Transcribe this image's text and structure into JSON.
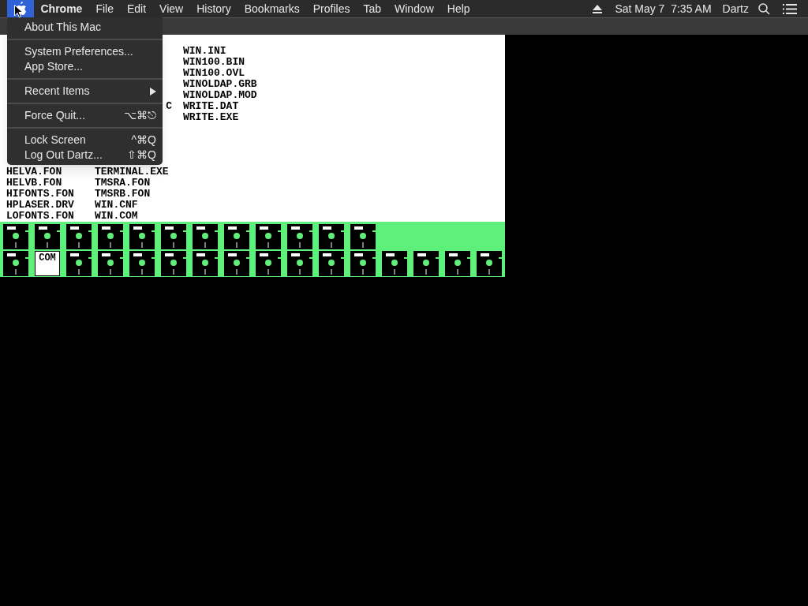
{
  "menu_bar": {
    "apple_selected": true,
    "items": [
      {
        "label": "Chrome",
        "bold": true,
        "selected": false
      },
      {
        "label": "File",
        "bold": false,
        "selected": false
      },
      {
        "label": "Edit",
        "bold": false,
        "selected": false
      },
      {
        "label": "View",
        "bold": false,
        "selected": false
      },
      {
        "label": "History",
        "bold": false,
        "selected": false
      },
      {
        "label": "Bookmarks",
        "bold": false,
        "selected": false
      },
      {
        "label": "Profiles",
        "bold": false,
        "selected": false
      },
      {
        "label": "Tab",
        "bold": false,
        "selected": false
      },
      {
        "label": "Window",
        "bold": false,
        "selected": false
      },
      {
        "label": "Help",
        "bold": false,
        "selected": false
      }
    ],
    "clock": "Sat May 7  7:35 AM",
    "user": "Dartz"
  },
  "apple_menu": [
    {
      "kind": "item",
      "label": "About This Mac"
    },
    {
      "kind": "separator"
    },
    {
      "kind": "item",
      "label": "System Preferences..."
    },
    {
      "kind": "item",
      "label": "App Store..."
    },
    {
      "kind": "separator"
    },
    {
      "kind": "item",
      "label": "Recent Items",
      "submenu": true
    },
    {
      "kind": "separator"
    },
    {
      "kind": "item",
      "label": "Force Quit...",
      "shortcut": "⌥⌘⎋"
    },
    {
      "kind": "separator"
    },
    {
      "kind": "item",
      "label": "Lock Screen",
      "shortcut": "^⌘Q"
    },
    {
      "kind": "item",
      "label": "Log Out Dartz...",
      "shortcut": "⇧⌘Q"
    }
  ],
  "listing_top": [
    {
      "column_3": "WIN.INI"
    },
    {
      "column_3": "WIN100.BIN"
    },
    {
      "column_3": "WIN100.OVL"
    },
    {
      "column_3": "WINOLDAP.GRB"
    },
    {
      "column_3": "WINOLDAP.MOD"
    },
    {
      "column_2": "C",
      "column_3": "WRITE.DAT"
    },
    {
      "column_3": "WRITE.EXE"
    }
  ],
  "listing_bottom": [
    {
      "column_1": "HELVA.FON",
      "column_2": "TERMINAL.EXE"
    },
    {
      "column_1": "HELVB.FON",
      "column_2": "TMSRA.FON"
    },
    {
      "column_1": "HIFONTS.FON",
      "column_2": "TMSRB.FON"
    },
    {
      "column_1": "HPLASER.DRV",
      "column_2": "WIN.CNF"
    },
    {
      "column_1": "LOFONTS.FON",
      "column_2": "WIN.COM"
    }
  ],
  "drive_bar": [
    [
      {
        "kind": "disk"
      },
      {
        "kind": "disk"
      },
      {
        "kind": "disk"
      },
      {
        "kind": "disk"
      },
      {
        "kind": "disk"
      },
      {
        "kind": "disk"
      },
      {
        "kind": "disk"
      },
      {
        "kind": "disk"
      },
      {
        "kind": "disk"
      },
      {
        "kind": "disk"
      },
      {
        "kind": "disk"
      },
      {
        "kind": "disk"
      }
    ],
    [
      {
        "kind": "disk"
      },
      {
        "kind": "label",
        "label": "COM"
      },
      {
        "kind": "disk"
      },
      {
        "kind": "disk"
      },
      {
        "kind": "disk"
      },
      {
        "kind": "disk"
      },
      {
        "kind": "disk"
      },
      {
        "kind": "disk"
      },
      {
        "kind": "disk"
      },
      {
        "kind": "disk"
      },
      {
        "kind": "disk"
      },
      {
        "kind": "disk"
      },
      {
        "kind": "disk"
      },
      {
        "kind": "disk"
      },
      {
        "kind": "disk"
      },
      {
        "kind": "disk"
      }
    ]
  ]
}
